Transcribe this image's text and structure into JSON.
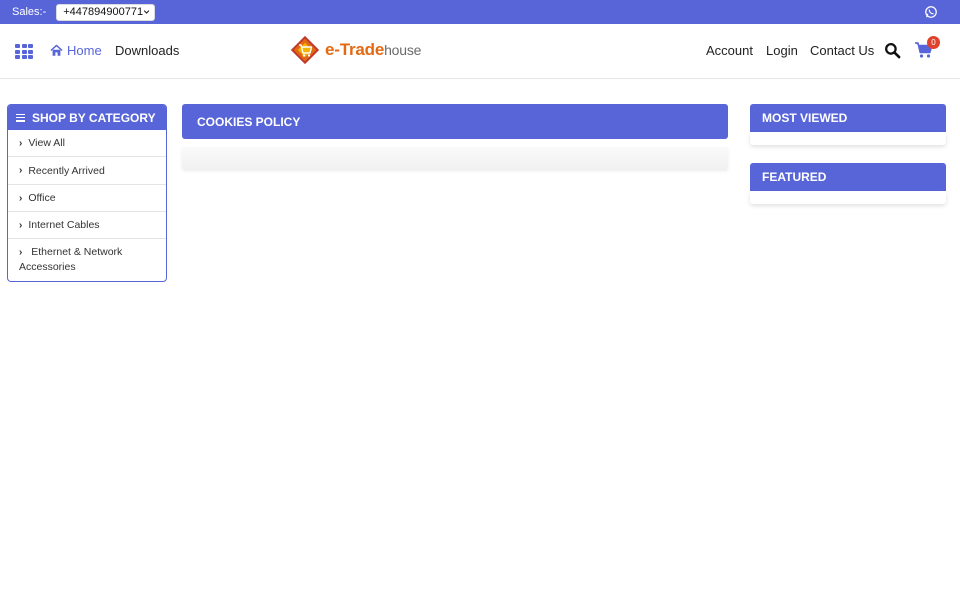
{
  "topbar": {
    "sales_label": "Sales:-",
    "sales_phone": "+447894900771",
    "whatsapp_icon": "whatsapp-icon"
  },
  "header": {
    "menu_icon": "grid-menu-icon",
    "home_label": "Home",
    "downloads_label": "Downloads",
    "logo": {
      "e_part": "e-Trade",
      "house_part": "house"
    },
    "account_label": "Account",
    "login_label": "Login",
    "contact_label": "Contact Us",
    "cart_count": "0"
  },
  "category_panel": {
    "title": "SHOP BY CATEGORY",
    "items": [
      {
        "label": "View All"
      },
      {
        "label": "Recently Arrived"
      },
      {
        "label": "Office"
      },
      {
        "label": "Internet Cables"
      },
      {
        "label": "Ethernet & Network Accessories"
      }
    ]
  },
  "main": {
    "title": "COOKIES POLICY"
  },
  "sidebar": {
    "most_viewed_title": "MOST VIEWED",
    "featured_title": "FEATURED"
  },
  "colors": {
    "accent": "#5865d9",
    "logo_orange": "#e36a12",
    "badge": "#e0432b"
  }
}
